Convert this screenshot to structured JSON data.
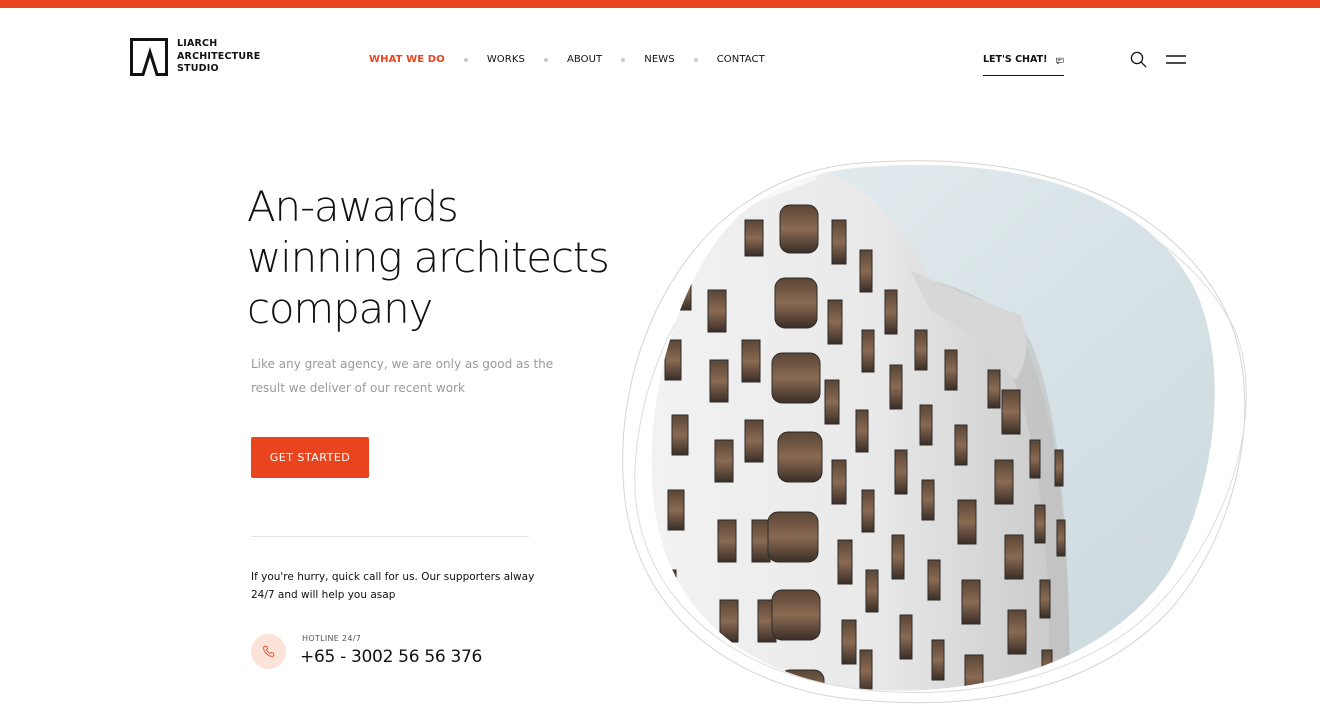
{
  "brand": {
    "logo_lines": [
      "LIARCH",
      "ARCHITECTURE",
      "STUDIO"
    ],
    "accent_color": "#e8451e"
  },
  "nav": {
    "items": [
      {
        "label": "WHAT WE DO",
        "active": true
      },
      {
        "label": "WORKS",
        "active": false
      },
      {
        "label": "ABOUT",
        "active": false
      },
      {
        "label": "NEWS",
        "active": false
      },
      {
        "label": "CONTACT",
        "active": false
      }
    ]
  },
  "header": {
    "chat_label": "LET'S CHAT!",
    "chat_icon": "chat-bubble-icon",
    "search_icon": "search-icon",
    "menu_icon": "hamburger-menu-icon"
  },
  "hero": {
    "title_lines": [
      "An-awards",
      "winning architects",
      "company"
    ],
    "subtitle_lines": [
      "Like any great agency, we are only as good as the",
      "result we deliver of our recent work"
    ],
    "cta_label": "GET STARTED"
  },
  "contact": {
    "help_lines": [
      "If you're hurry, quick call for us. Our supporters alway",
      "24/7 and will help you asap"
    ],
    "hotline_label": "HOTLINE 24/7",
    "hotline_number": "+65 - 3002 56 56 376",
    "phone_icon": "phone-icon"
  }
}
